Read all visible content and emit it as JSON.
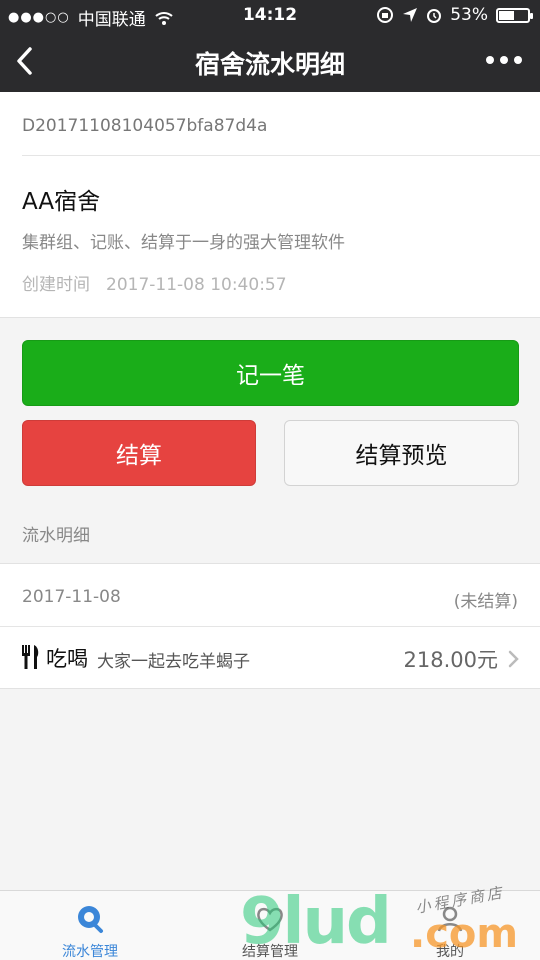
{
  "status_bar": {
    "signal": "●●●○○",
    "carrier": "中国联通",
    "time": "14:12",
    "battery": "53%",
    "battery_level": 0.53
  },
  "nav": {
    "title": "宿舍流水明细"
  },
  "dorm": {
    "order_id": "D20171108104057bfa87d4a",
    "name": "AA宿舍",
    "description": "集群组、记账、结算于一身的强大管理软件",
    "created_label": "创建时间",
    "created_value": "2017-11-08 10:40:57"
  },
  "actions": {
    "record": "记一笔",
    "settle": "结算",
    "preview": "结算预览"
  },
  "section": {
    "title": "流水明细"
  },
  "records": {
    "date": "2017-11-08",
    "status": "(未结算)",
    "items": [
      {
        "category": "吃喝",
        "note": "大家一起去吃羊蝎子",
        "amount": "218.00元"
      }
    ]
  },
  "tabbar": {
    "tabs": [
      {
        "label": "流水管理"
      },
      {
        "label": "结算管理"
      },
      {
        "label": "我的"
      }
    ]
  },
  "watermark": {
    "brand": "9lud",
    "domain": ".com",
    "tagline": "小程序商店"
  },
  "colors": {
    "nav_bg": "#2b2b2d",
    "primary_green": "#1aad19",
    "warn_red": "#e64340",
    "tab_active": "#3b86d8"
  }
}
